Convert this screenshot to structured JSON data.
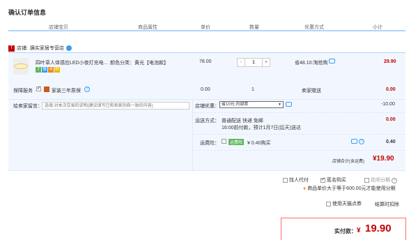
{
  "page": {
    "title": "确认订单信息"
  },
  "columns": [
    "店铺宝贝",
    "商品属性",
    "单价",
    "数量",
    "优惠方式",
    "小计"
  ],
  "shop": {
    "label": "店铺:",
    "name": "胰实家居专营店"
  },
  "item": {
    "name": "四叶草人体感应LED小夜灯充电...",
    "attr": "颜色分类：黄光【电池款】",
    "price": "78.00",
    "qty": "1",
    "discount": "省48.10:淘抢购",
    "subtotal": "29.90",
    "minus": "-",
    "plus": "+"
  },
  "service": {
    "label": "保障服务",
    "name": "家装三年质保",
    "price": "0.00",
    "qty": "1",
    "method": "卖家赠送",
    "subtotal": "0.00"
  },
  "message": {
    "label": "给卖家留言：",
    "placeholder": "选填:对本次交易的说明(建议填写已和卖家协商一致的内容)"
  },
  "shop_discount": {
    "label": "店铺优惠：",
    "selected": "省10元:内部券",
    "value": "-10.00"
  },
  "delivery": {
    "label": "运送方式：",
    "line1": "普通配送 快递 免邮",
    "line2": "16:00前付款，预计1月7日(后天)送达",
    "value": "0.00"
  },
  "insurance": {
    "label": "运费险：",
    "tag": "运费险",
    "text": "¥ 0.40购买",
    "value": "0.40"
  },
  "shop_total": {
    "label": "店铺合计(含运费)",
    "value": "¥19.90"
  },
  "options": {
    "proxy_label": "找人代付",
    "anon_label": "匿名购买",
    "huabei_label": "花呗分期",
    "huabei_note": "商品单价大于等于600.00元才能使用分期",
    "points_label": "使用天猫点券",
    "points_note": "结算时扣除"
  },
  "pay": {
    "label": "实付款：",
    "currency": "¥",
    "amount": "19.90"
  },
  "colors": {
    "accent": "#c40000",
    "border": "#b2d1ff",
    "bg": "#f2f7ff"
  }
}
